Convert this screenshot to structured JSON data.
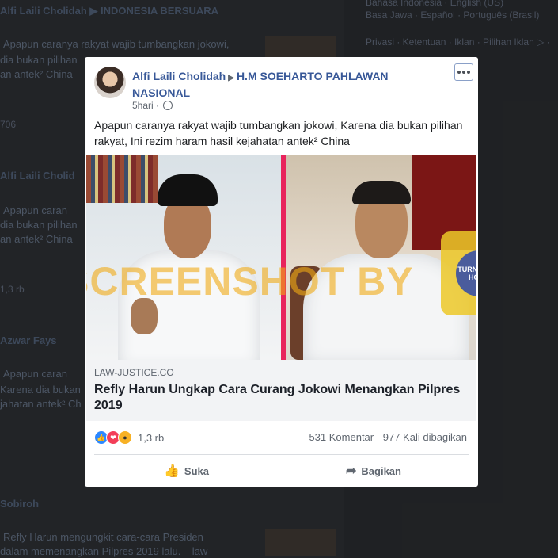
{
  "background": {
    "feed": [
      {
        "name": "Alfi Laili Cholidah",
        "target": "INDONESIA BERSUARA",
        "text1": "Apapun caranya rakyat wajib tumbangkan jokowi,",
        "text2": "dia bukan pilihan",
        "text3": "an antek² China",
        "count": "706"
      },
      {
        "name": "Alfi Laili Cholid",
        "text1": "Apapun caran",
        "text2": "dia bukan pilihan",
        "text3": "an antek² China",
        "count": "1,3 rb"
      },
      {
        "name": "Azwar Fays",
        "text1": "Apapun caran",
        "text2": "Karena dia bukan",
        "text3": "jahatan antek² Ch"
      },
      {
        "name": "Sobiroh",
        "text1": "Refly Harun mengungkit cara-cara Presiden",
        "text2": "dalam memenangkan Pilpres 2019 lalu. – law-"
      }
    ],
    "languages_line1": "Bahasa Indonesia · English (US)",
    "languages_line2": "Basa Jawa · Español · Português (Brasil)",
    "footer_links": "Privasi · Ketentuan · Iklan · Pilihan Iklan ▷ ·"
  },
  "post": {
    "author": "Alfi Laili Cholidah",
    "arrow": "▶",
    "target": "H.M SOEHARTO PAHLAWAN NASIONAL",
    "time": "5hari",
    "separator": "·",
    "text": "Apapun caranya rakyat wajib tumbangkan jokowi, Karena dia bukan pilihan rakyat, Ini rezim haram hasil kejahatan antek² China",
    "watermark": "SCREENSHOT BY",
    "badge": "TURN BACK HOAX",
    "info_icon": "i",
    "link": {
      "domain": "LAW-JUSTICE.CO",
      "title": "Refly Harun Ungkap Cara Curang Jokowi Menangkan Pilpres 2019"
    },
    "reaction_count": "1,3 rb",
    "comments": "531 Komentar",
    "shares": "977 Kali dibagikan",
    "actions": {
      "like_label": "Suka",
      "share_label": "Bagikan"
    }
  },
  "icons": {
    "like": "thumbs-up-icon",
    "share": "share-arrow-icon",
    "menu": "more-horizontal-icon",
    "globe": "globe-icon"
  }
}
